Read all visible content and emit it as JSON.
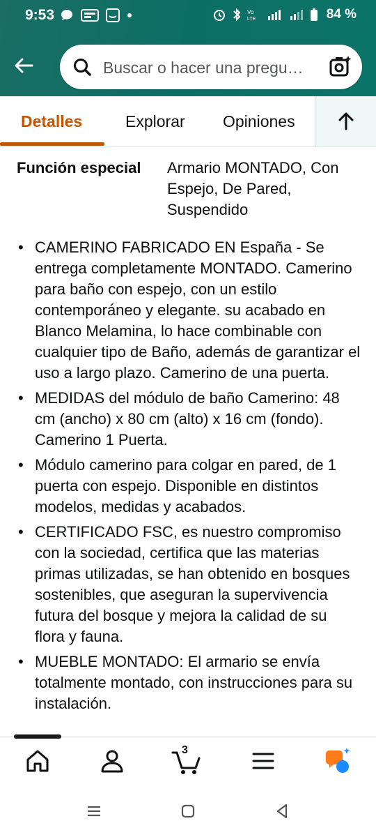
{
  "status_bar": {
    "time": "9:53",
    "battery": "84 %"
  },
  "search": {
    "placeholder": "Buscar o hacer una pregu…"
  },
  "tabs": [
    {
      "label": "Detalles",
      "active": true
    },
    {
      "label": "Explorar",
      "active": false
    },
    {
      "label": "Opiniones",
      "active": false
    }
  ],
  "spec": {
    "key": "Función especial",
    "value": "Armario MONTADO, Con Espejo, De Pared, Suspendido"
  },
  "bullets": [
    "CAMERINO FABRICADO EN España - Se entrega completamente MONTADO. Camerino para baño con espejo, con un estilo contemporáneo y elegante. su acabado en Blanco Melamina, lo hace combinable con cualquier tipo de Baño, además de garantizar el uso a largo plazo. Camerino de una puerta.",
    "MEDIDAS del módulo de baño Camerino: 48 cm (ancho) x 80 cm (alto) x 16 cm (fondo). Camerino 1 Puerta.",
    "Módulo camerino para colgar en pared, de 1 puerta con espejo. Disponible en distintos modelos, medidas y acabados.",
    "CERTIFICADO FSC, es nuestro compromiso con la sociedad, certifica que las materias primas utilizadas, se han obtenido en bosques sostenibles, que aseguran la supervivencia futura del bosque y mejora la calidad de su flora y fauna.",
    "MUEBLE MONTADO: El armario se envía totalmente montado, con instrucciones para su instalación."
  ],
  "bottom_nav": {
    "cart_count": "3",
    "items": [
      "home-icon",
      "user-icon",
      "cart-icon",
      "menu-icon",
      "rufus-icon"
    ]
  },
  "colors": {
    "header": "#0c6f66",
    "accent": "#c45500",
    "rufus_orange": "#ff7a1a",
    "rufus_blue": "#1a8cff"
  }
}
